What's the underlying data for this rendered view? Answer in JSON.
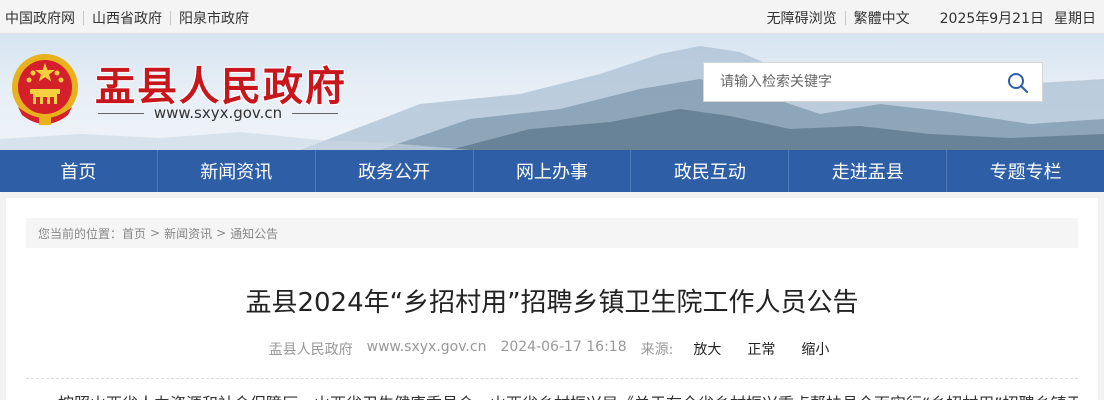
{
  "topbar": {
    "links": [
      "中国政府网",
      "山西省政府",
      "阳泉市政府"
    ],
    "accessibility": "无障碍浏览",
    "traditional": "繁體中文",
    "date": "2025年9月21日",
    "weekday": "星期日"
  },
  "header": {
    "site_title": "盂县人民政府",
    "site_url": "www.sxyx.gov.cn",
    "emblem_icon": "national-emblem-icon",
    "search": {
      "placeholder": "请输入检索关键字",
      "icon": "search-icon"
    }
  },
  "nav": {
    "items": [
      "首页",
      "新闻资讯",
      "政务公开",
      "网上办事",
      "政民互动",
      "走进盂县",
      "专题专栏"
    ]
  },
  "breadcrumb": {
    "prefix": "您当前的位置：",
    "items": [
      "首页",
      "新闻资讯",
      "通知公告"
    ],
    "separator": ">"
  },
  "article": {
    "title": "盂县2024年“乡招村用”招聘乡镇卫生院工作人员公告",
    "source": "盂县人民政府",
    "url": "www.sxyx.gov.cn",
    "datetime": "2024-06-17 16:18",
    "font_label": "来源:",
    "size_options": [
      "放大",
      "正常",
      "缩小"
    ],
    "first_line": "按照山西省人力资源和社会保障厅、山西省卫生健康委员会、山西省乡村振兴局《关于在全省乡村振兴重点帮扶县全面实行“乡招村用”招聘乡镇卫"
  },
  "colors": {
    "nav_bg": "#2e5fa6",
    "title_red": "#c8161d"
  }
}
